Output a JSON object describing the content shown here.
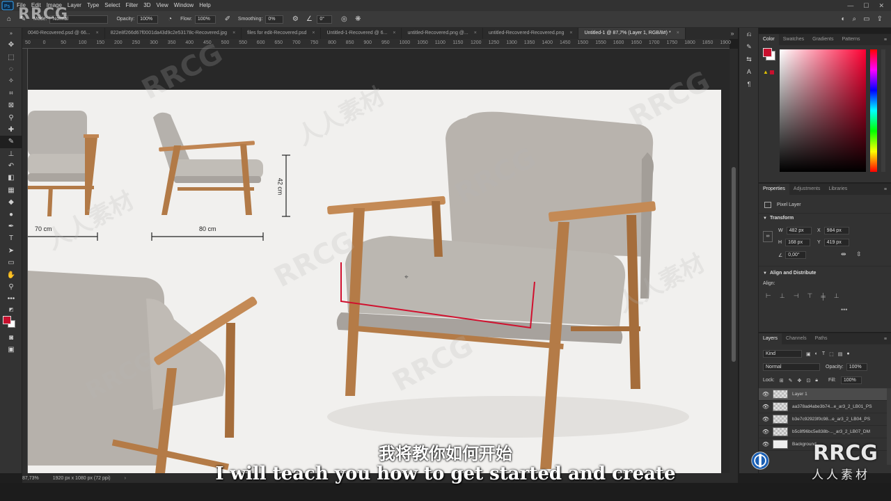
{
  "menu": [
    "File",
    "Edit",
    "Image",
    "Layer",
    "Type",
    "Select",
    "Filter",
    "3D",
    "View",
    "Window",
    "Help"
  ],
  "options": {
    "mode_label": "Mode:",
    "mode_value": "Normal",
    "opacity_label": "Opacity:",
    "opacity_value": "100%",
    "flow_label": "Flow:",
    "flow_value": "100%",
    "smoothing_label": "Smoothing:",
    "smoothing_value": "0%",
    "angle_value": "0°"
  },
  "tabs": [
    {
      "label": "0040-Recovered.psd @ 66...",
      "active": false
    },
    {
      "label": "822e8f266d67f0001da43d9c2e53178c-Recovered.jpg",
      "active": false
    },
    {
      "label": "files for edit-Recovered.psd",
      "active": false
    },
    {
      "label": "Untitled-1-Recovered @ 6...",
      "active": false
    },
    {
      "label": "untitled-Recovered.png @...",
      "active": false
    },
    {
      "label": "untitled-Recovered-Recovered.png",
      "active": false
    },
    {
      "label": "Untitled-1 @ 87,7% (Layer 1, RGB/8#) *",
      "active": true
    }
  ],
  "ruler_ticks": [
    "50",
    "0",
    "50",
    "100",
    "150",
    "200",
    "250",
    "300",
    "350",
    "400",
    "450",
    "500",
    "550",
    "600",
    "650",
    "700",
    "750",
    "800",
    "850",
    "900",
    "950",
    "1000",
    "1050",
    "1100",
    "1150",
    "1200",
    "1250",
    "1300",
    "1350",
    "1400",
    "1450",
    "1500",
    "1550",
    "1600",
    "1650",
    "1700",
    "1750",
    "1800",
    "1850",
    "1900"
  ],
  "canvas": {
    "dim_70": "70 cm",
    "dim_80": "80 cm",
    "dim_42": "42 cm"
  },
  "status": {
    "zoom": "87,73%",
    "doc_size": "1920 px x 1080 px (72 ppi)"
  },
  "color_panel": {
    "tabs": [
      "Color",
      "Swatches",
      "Gradients",
      "Patterns"
    ],
    "foreground": "#c8102e",
    "background": "#ffffff"
  },
  "properties": {
    "tabs": [
      "Properties",
      "Adjustments",
      "Libraries"
    ],
    "layer_type": "Pixel Layer",
    "transform_title": "Transform",
    "w_label": "W",
    "w_value": "482 px",
    "h_label": "H",
    "h_value": "168 px",
    "x_label": "X",
    "x_value": "984 px",
    "y_label": "Y",
    "y_value": "419 px",
    "angle_value": "0,00°",
    "align_title": "Align and Distribute",
    "align_label": "Align:"
  },
  "layers": {
    "tabs": [
      "Layers",
      "Channels",
      "Paths"
    ],
    "kind": "Kind",
    "blend": "Normal",
    "opacity_label": "Opacity:",
    "opacity_value": "100%",
    "lock_label": "Lock:",
    "fill_label": "Fill:",
    "fill_value": "100%",
    "items": [
      {
        "name": "Layer 1",
        "selected": true
      },
      {
        "name": "aa378ad4abe3b74...e_ar3_2_LB01_PS",
        "selected": false
      },
      {
        "name": "b3e7c92923f0c98...e_ar3_2_LB04_PS",
        "selected": false
      },
      {
        "name": "b5c8f96bc5e838b-..._ar3_2_LB07_DM",
        "selected": false
      },
      {
        "name": "Background",
        "selected": false
      }
    ]
  },
  "subtitles": {
    "cn": "我将教你如何开始",
    "en": "I will teach you how to get started and create"
  },
  "watermarks": {
    "top_left": "RRCG",
    "brand": "RRCG",
    "brand_cn": "人人素材",
    "repeat_en": "RRCG",
    "repeat_cn": "人人素材"
  }
}
